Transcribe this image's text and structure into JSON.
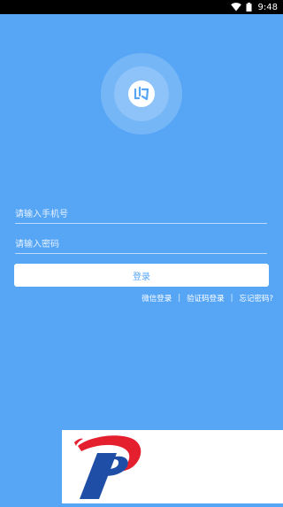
{
  "status_bar": {
    "time": "9:48",
    "icons": [
      "wifi-icon",
      "battery-icon"
    ]
  },
  "logo": {
    "icon": "app-logo-icon",
    "colors": {
      "ring": "#ffffff",
      "glyph": "#57a6f6"
    }
  },
  "form": {
    "phone_placeholder": "请输入手机号",
    "phone_value": "",
    "password_placeholder": "请输入密码",
    "password_value": "",
    "login_label": "登录"
  },
  "links": {
    "wechat_login": "微信登录",
    "separator": "|",
    "code_login": "验证码登录",
    "forgot_password": "忘记密码?"
  },
  "ad": {
    "icon": "brand-logo-icon",
    "colors": {
      "red": "#e5202e",
      "blue": "#1f4ea6"
    }
  },
  "theme": {
    "background": "#57a6f6",
    "status_bar": "#000000"
  }
}
